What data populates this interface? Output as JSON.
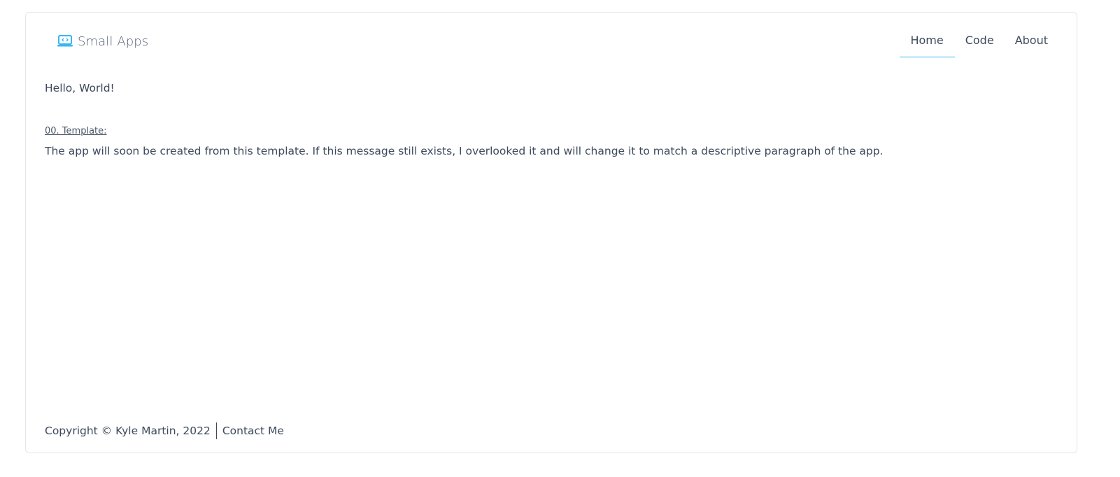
{
  "brand": {
    "name": "Small Apps",
    "icon": "laptop-code-icon",
    "icon_color": "#38b6f0"
  },
  "nav": {
    "items": [
      {
        "label": "Home",
        "active": true
      },
      {
        "label": "Code",
        "active": false
      },
      {
        "label": "About",
        "active": false
      }
    ],
    "active_underline_color": "#38b6f0"
  },
  "main": {
    "greeting": "Hello, World!",
    "section_label": "00. Template:",
    "description": "The app will soon be created from this template. If this message still exists, I overlooked it and will change it to match a descriptive paragraph of the app."
  },
  "footer": {
    "copyright": "Copyright © Kyle Martin, 2022",
    "contact_label": "Contact Me"
  }
}
